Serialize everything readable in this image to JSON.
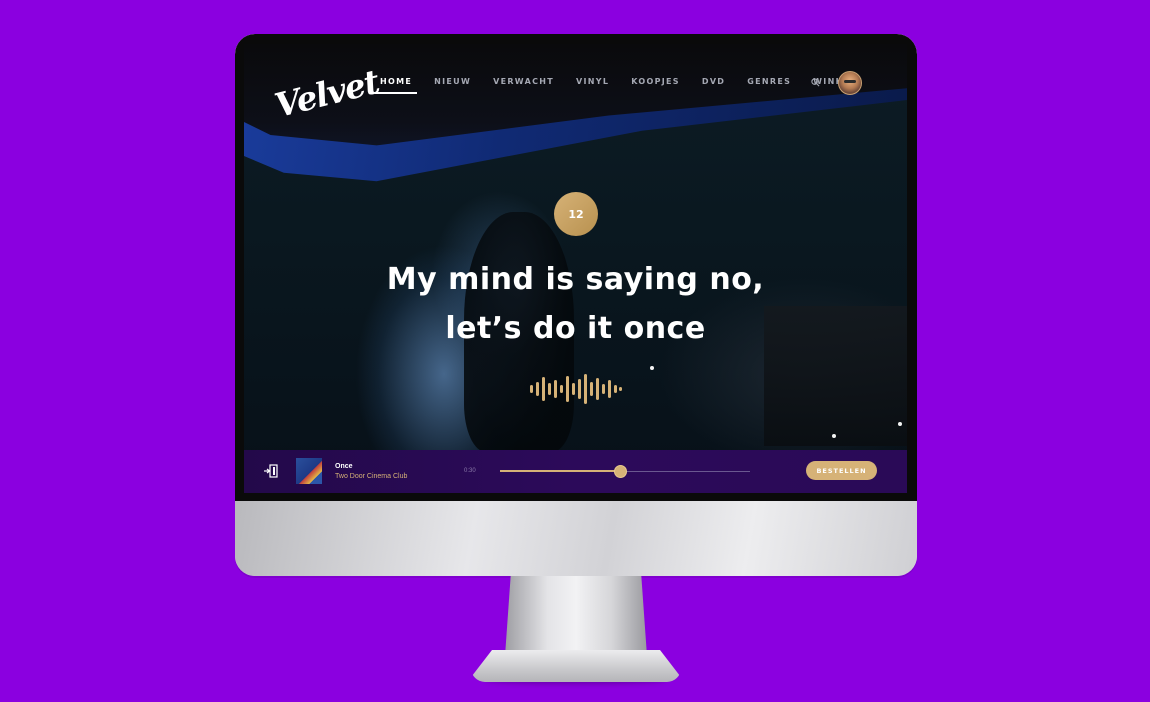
{
  "brand": {
    "logo_text": "Velvet"
  },
  "nav": {
    "items": [
      {
        "label": "HOME",
        "active": true
      },
      {
        "label": "NIEUW"
      },
      {
        "label": "VERWACHT"
      },
      {
        "label": "VINYL"
      },
      {
        "label": "KOOPJES"
      },
      {
        "label": "DVD"
      },
      {
        "label": "GENRES"
      },
      {
        "label": "WINKELS"
      }
    ],
    "search_icon": "search-icon",
    "avatar_icon": "user-avatar"
  },
  "hero": {
    "badge": "12",
    "headline_line1": "My mind is saying no,",
    "headline_line2": "let’s do it once",
    "waveform_icon": "audio-waveform-icon"
  },
  "player": {
    "song_title": "Once",
    "artist": "Two Door Cinema Club",
    "time": "0:30",
    "progress": 0.48,
    "order_button": "BESTELLEN",
    "exit_icon": "exit-icon"
  },
  "colors": {
    "background": "#8b00e0",
    "accent_gold": "#d6b277",
    "player_bar": "#2c0a5a",
    "nav_text": "#a5a8b3"
  }
}
